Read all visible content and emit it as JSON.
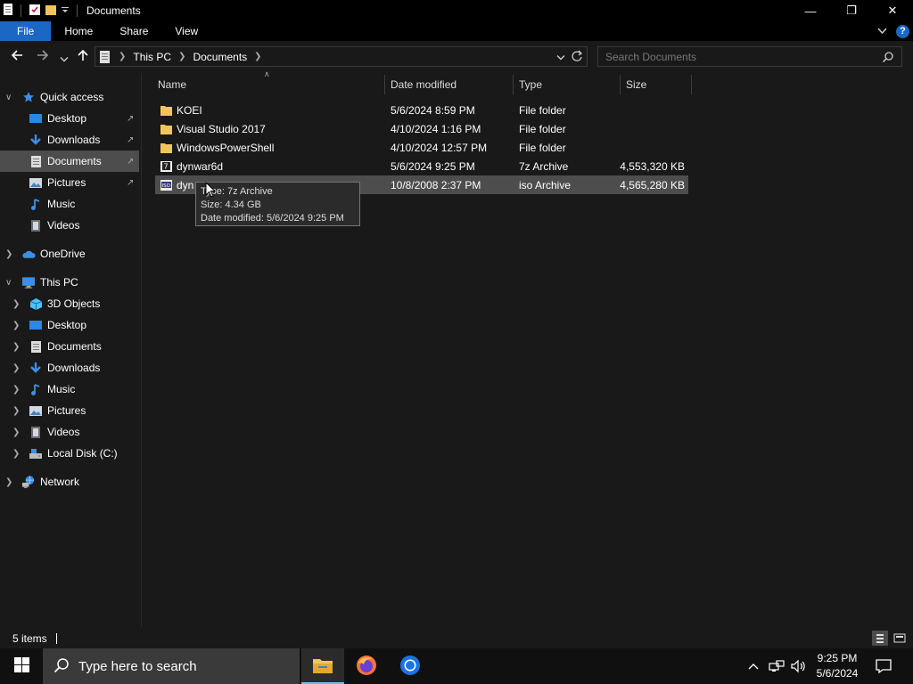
{
  "window": {
    "title": "Documents",
    "minimize_glyph": "—",
    "restore_glyph": "❐",
    "close_glyph": "✕"
  },
  "ribbon": {
    "tabs": [
      "File",
      "Home",
      "Share",
      "View"
    ],
    "help": "?"
  },
  "address": {
    "crumbs": [
      "This PC",
      "Documents"
    ]
  },
  "search": {
    "placeholder": "Search Documents"
  },
  "nav_pane": {
    "quick_access": "Quick access",
    "quick_items": [
      "Desktop",
      "Downloads",
      "Documents",
      "Pictures",
      "Music",
      "Videos"
    ],
    "onedrive": "OneDrive",
    "this_pc": "This PC",
    "pc_items": [
      "3D Objects",
      "Desktop",
      "Documents",
      "Downloads",
      "Music",
      "Pictures",
      "Videos",
      "Local Disk (C:)"
    ],
    "network": "Network",
    "selected": "Documents"
  },
  "columns": [
    "Name",
    "Date modified",
    "Type",
    "Size"
  ],
  "files": [
    {
      "name": "KOEI",
      "date": "5/6/2024 8:59 PM",
      "type": "File folder",
      "size": "",
      "icon": "folder-icon"
    },
    {
      "name": "Visual Studio 2017",
      "date": "4/10/2024 1:16 PM",
      "type": "File folder",
      "size": "",
      "icon": "folder-icon"
    },
    {
      "name": "WindowsPowerShell",
      "date": "4/10/2024 12:57 PM",
      "type": "File folder",
      "size": "",
      "icon": "folder-icon"
    },
    {
      "name": "dynwar6d",
      "date": "5/6/2024 9:25 PM",
      "type": "7z Archive",
      "size": "4,553,320 KB",
      "icon": "7z-archive-icon"
    },
    {
      "name": "dyn",
      "date": "10/8/2008 2:37 PM",
      "type": "iso Archive",
      "size": "4,565,280 KB",
      "icon": "iso-archive-icon"
    }
  ],
  "tooltip": {
    "type_line": "Type: 7z Archive",
    "size_line": "Size: 4.34 GB",
    "date_line": "Date modified: 5/6/2024 9:25 PM"
  },
  "status": {
    "items": "5 items"
  },
  "taskbar": {
    "search_text": "Type here to search",
    "time": "9:25 PM",
    "date": "5/6/2024",
    "apps": [
      "file-explorer-icon",
      "firefox-icon",
      "chrome-icon"
    ]
  },
  "colors": {
    "accent": "#1b67c4",
    "selection": "#4d4d4d",
    "folder": "#f2c55c",
    "background": "#191919"
  }
}
